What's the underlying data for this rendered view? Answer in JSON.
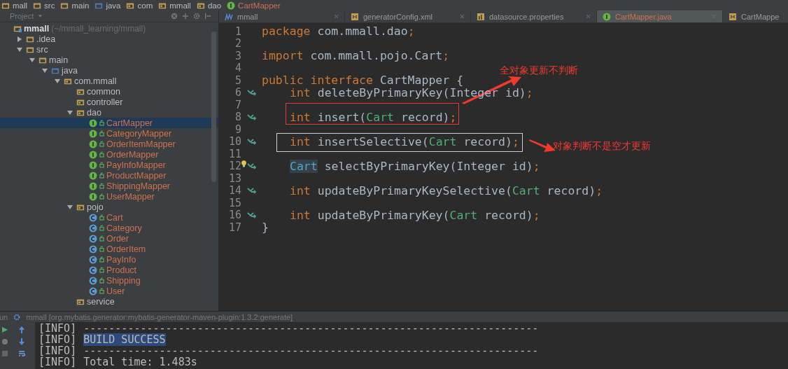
{
  "breadcrumbs": [
    {
      "kind": "module",
      "label": "mall"
    },
    {
      "kind": "folder",
      "label": "src"
    },
    {
      "kind": "folder",
      "label": "main"
    },
    {
      "kind": "source",
      "label": "java"
    },
    {
      "kind": "package",
      "label": "com"
    },
    {
      "kind": "package",
      "label": "mmall"
    },
    {
      "kind": "package",
      "label": "dao"
    },
    {
      "kind": "interface",
      "label": "CartMapper",
      "untracked": true
    }
  ],
  "project": {
    "title": "Project",
    "tree": [
      {
        "kind": "module",
        "label": "mmall",
        "path": "(~/mmall_learning/mmall)",
        "untracked": false,
        "children": [
          {
            "kind": "folder",
            "label": ".idea",
            "expanded": false,
            "untracked": false
          },
          {
            "kind": "folder",
            "label": "src",
            "expanded": true,
            "untracked": false,
            "children": [
              {
                "kind": "folder",
                "label": "main",
                "expanded": true,
                "untracked": false,
                "children": [
                  {
                    "kind": "source",
                    "label": "java",
                    "expanded": true,
                    "untracked": false,
                    "children": [
                      {
                        "kind": "package",
                        "label": "com.mmall",
                        "expanded": true,
                        "untracked": false,
                        "children": [
                          {
                            "kind": "package",
                            "label": "common",
                            "untracked": false
                          },
                          {
                            "kind": "package",
                            "label": "controller",
                            "untracked": false
                          },
                          {
                            "kind": "package",
                            "label": "dao",
                            "expanded": true,
                            "untracked": false,
                            "children": [
                              {
                                "kind": "interface",
                                "label": "CartMapper",
                                "untracked": true,
                                "selected": true
                              },
                              {
                                "kind": "interface",
                                "label": "CategoryMapper",
                                "untracked": true,
                                "selected": false
                              },
                              {
                                "kind": "interface",
                                "label": "OrderItemMapper",
                                "untracked": true,
                                "selected": false
                              },
                              {
                                "kind": "interface",
                                "label": "OrderMapper",
                                "untracked": true,
                                "selected": false
                              },
                              {
                                "kind": "interface",
                                "label": "PayInfoMapper",
                                "untracked": true,
                                "selected": false
                              },
                              {
                                "kind": "interface",
                                "label": "ProductMapper",
                                "untracked": true,
                                "selected": false
                              },
                              {
                                "kind": "interface",
                                "label": "ShippingMapper",
                                "untracked": true,
                                "selected": false
                              },
                              {
                                "kind": "interface",
                                "label": "UserMapper",
                                "untracked": true,
                                "selected": false
                              }
                            ]
                          },
                          {
                            "kind": "package",
                            "label": "pojo",
                            "expanded": true,
                            "untracked": false,
                            "children": [
                              {
                                "kind": "class",
                                "label": "Cart",
                                "untracked": true,
                                "selected": false
                              },
                              {
                                "kind": "class",
                                "label": "Category",
                                "untracked": true,
                                "selected": false
                              },
                              {
                                "kind": "class",
                                "label": "Order",
                                "untracked": true,
                                "selected": false
                              },
                              {
                                "kind": "class",
                                "label": "OrderItem",
                                "untracked": true,
                                "selected": false
                              },
                              {
                                "kind": "class",
                                "label": "PayInfo",
                                "untracked": true,
                                "selected": false
                              },
                              {
                                "kind": "class",
                                "label": "Product",
                                "untracked": true,
                                "selected": false
                              },
                              {
                                "kind": "class",
                                "label": "Shipping",
                                "untracked": true,
                                "selected": false
                              },
                              {
                                "kind": "class",
                                "label": "User",
                                "untracked": true,
                                "selected": false
                              }
                            ]
                          },
                          {
                            "kind": "package",
                            "label": "service",
                            "untracked": false
                          }
                        ]
                      }
                    ]
                  }
                ]
              }
            ]
          }
        ]
      }
    ]
  },
  "tabs": [
    {
      "kind": "module",
      "label": "mmall",
      "selected": false
    },
    {
      "kind": "xml",
      "label": "generatorConfig.xml",
      "selected": false
    },
    {
      "kind": "properties",
      "label": "datasource.properties",
      "selected": false
    },
    {
      "kind": "interface",
      "label": "CartMapper.java",
      "selected": true
    },
    {
      "kind": "xml",
      "label": "CartMappe",
      "selected": false
    }
  ],
  "editor": {
    "lines": [
      {
        "number": "1",
        "marker": false,
        "intention": false,
        "tokens": [
          {
            "kind": "kw",
            "text": "package"
          },
          {
            "kind": "plain",
            "text": " com.mmall.dao"
          },
          {
            "kind": "semi",
            "text": ";"
          }
        ]
      },
      {
        "number": "2",
        "marker": false,
        "intention": false
      },
      {
        "number": "3",
        "marker": false,
        "intention": false,
        "tokens": [
          {
            "kind": "kw",
            "text": "import"
          },
          {
            "kind": "plain",
            "text": " com.mmall.pojo.Cart"
          },
          {
            "kind": "semi",
            "text": ";"
          }
        ]
      },
      {
        "number": "4",
        "marker": false,
        "intention": false
      },
      {
        "number": "5",
        "marker": false,
        "intention": false,
        "tokens": [
          {
            "kind": "kw",
            "text": "public interface"
          },
          {
            "kind": "plain",
            "text": " CartMapper {"
          }
        ]
      },
      {
        "number": "6",
        "marker": true,
        "intention": false,
        "indented": true,
        "tokens": [
          {
            "kind": "kw",
            "text": "int"
          },
          {
            "kind": "plain",
            "text": " deleteByPrimaryKey(Integer id)"
          },
          {
            "kind": "semi",
            "text": ";"
          }
        ]
      },
      {
        "number": "7",
        "marker": false,
        "intention": false
      },
      {
        "number": "8",
        "marker": true,
        "intention": false,
        "indented": true,
        "tokens": [
          {
            "kind": "kw",
            "text": "int"
          },
          {
            "kind": "plain",
            "text": " insert("
          },
          {
            "kind": "type",
            "text": "Cart"
          },
          {
            "kind": "plain",
            "text": " record)"
          },
          {
            "kind": "semi",
            "text": ";"
          }
        ]
      },
      {
        "number": "9",
        "marker": false,
        "intention": false
      },
      {
        "number": "10",
        "marker": true,
        "intention": false,
        "indented": true,
        "tokens": [
          {
            "kind": "kw",
            "text": "int"
          },
          {
            "kind": "plain",
            "text": " insertSelective("
          },
          {
            "kind": "type",
            "text": "Cart"
          },
          {
            "kind": "plain",
            "text": " record)"
          },
          {
            "kind": "semi",
            "text": ";"
          }
        ]
      },
      {
        "number": "11",
        "marker": false,
        "intention": false
      },
      {
        "number": "12",
        "marker": true,
        "intention": true,
        "indented": true,
        "tokens": [
          {
            "kind": "marked",
            "text": "Cart"
          },
          {
            "kind": "plain",
            "text": " selectByPrimaryKey(Integer id)"
          },
          {
            "kind": "semi",
            "text": ";"
          }
        ]
      },
      {
        "number": "13",
        "marker": false,
        "intention": false
      },
      {
        "number": "14",
        "marker": true,
        "intention": false,
        "indented": true,
        "tokens": [
          {
            "kind": "kw",
            "text": "int"
          },
          {
            "kind": "plain",
            "text": " updateByPrimaryKeySelective("
          },
          {
            "kind": "type",
            "text": "Cart"
          },
          {
            "kind": "plain",
            "text": " record)"
          },
          {
            "kind": "semi",
            "text": ";"
          }
        ]
      },
      {
        "number": "15",
        "marker": false,
        "intention": false
      },
      {
        "number": "16",
        "marker": true,
        "intention": false,
        "indented": true,
        "tokens": [
          {
            "kind": "kw",
            "text": "int"
          },
          {
            "kind": "plain",
            "text": " updateByPrimaryKey("
          },
          {
            "kind": "type",
            "text": "Cart"
          },
          {
            "kind": "plain",
            "text": " record)"
          },
          {
            "kind": "semi",
            "text": ";"
          }
        ]
      },
      {
        "number": "17",
        "marker": false,
        "intention": false,
        "tokens": [
          {
            "kind": "plain",
            "text": "}"
          }
        ]
      }
    ],
    "annotations": [
      {
        "kind": "box",
        "color": "#e53a30"
      },
      {
        "kind": "box",
        "color": "#cfcfcf"
      },
      {
        "kind": "arrow",
        "color": "#f2392c"
      },
      {
        "kind": "note",
        "text": "全对象更新不判断",
        "color": "#f2392c"
      },
      {
        "kind": "arrow",
        "color": "#f2392c"
      },
      {
        "kind": "note",
        "text": "对象判断不是空才更新",
        "color": "#f2392c"
      }
    ]
  },
  "run": {
    "label": "un",
    "title": "mmall [org.mybatis.generator:mybatis-generator-maven-plugin:1.3.2:generate]",
    "lines": [
      {
        "prefix": "[INFO]",
        "text": "------------------------------------------------------------------------",
        "selected": false
      },
      {
        "prefix": "[INFO]",
        "text": "BUILD SUCCESS",
        "selected": true
      },
      {
        "prefix": "[INFO]",
        "text": "------------------------------------------------------------------------",
        "selected": false
      },
      {
        "prefix": "[INFO]",
        "text": "Total time: 1.483s",
        "selected": false
      }
    ]
  }
}
